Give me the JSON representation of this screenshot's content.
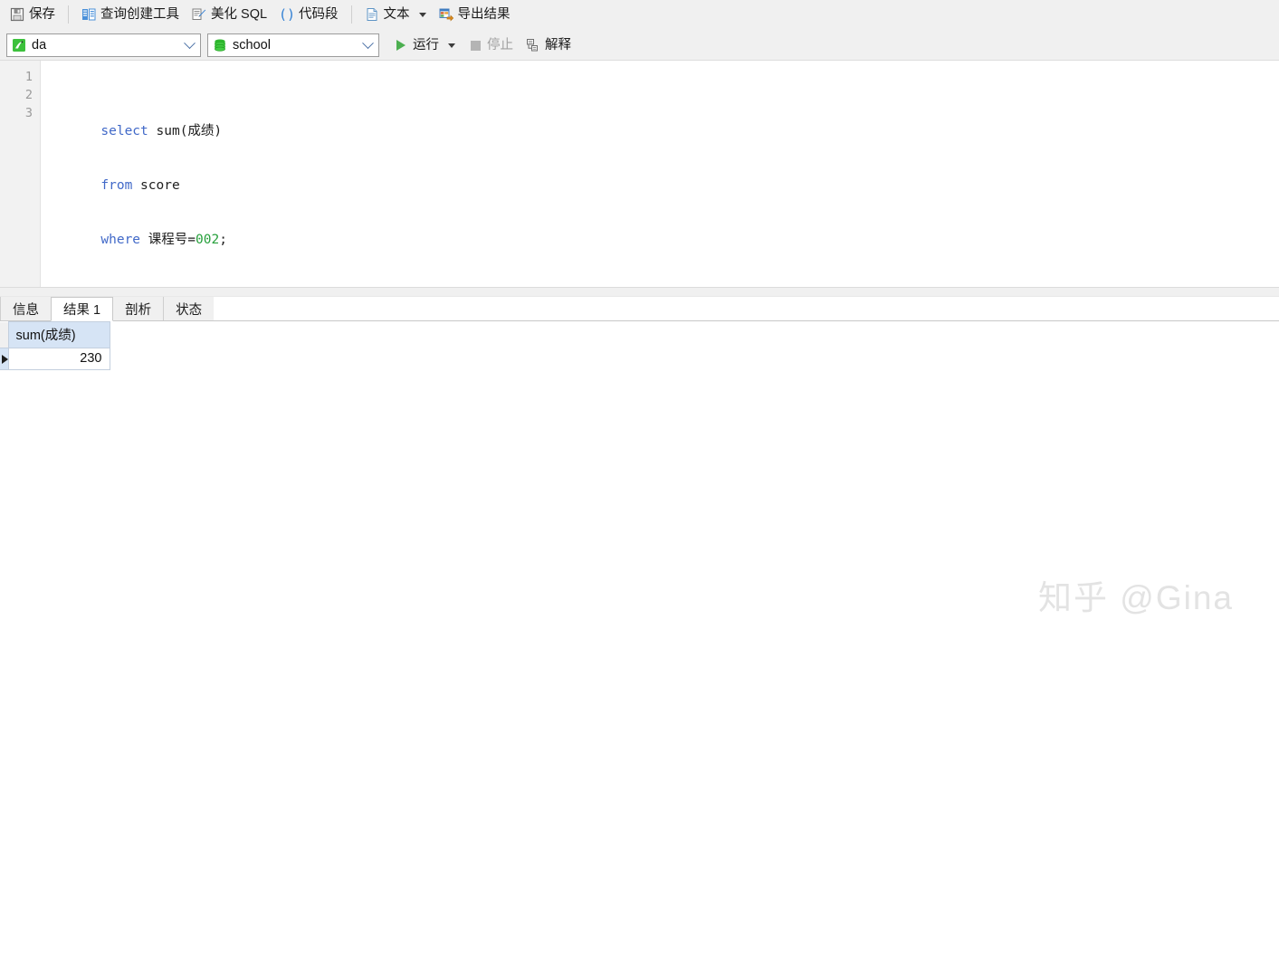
{
  "toolbar_main": {
    "buttons": [
      {
        "id": "save",
        "label": "保存",
        "icon": "save-icon"
      },
      {
        "id": "query-builder",
        "label": "查询创建工具",
        "icon": "query-builder-icon"
      },
      {
        "id": "beautify-sql",
        "label": "美化 SQL",
        "icon": "beautify-icon"
      },
      {
        "id": "code-snippet",
        "label": "代码段",
        "icon": "code-snippet-icon"
      },
      {
        "id": "text",
        "label": "文本",
        "icon": "text-file-icon",
        "has_dropdown": true
      },
      {
        "id": "export-result",
        "label": "导出结果",
        "icon": "export-icon"
      }
    ]
  },
  "toolbar_secondary": {
    "connection": {
      "value": "da",
      "icon": "connection-icon"
    },
    "database": {
      "value": "school",
      "icon": "database-icon"
    },
    "run": {
      "label": "运行",
      "icon": "play-icon",
      "has_dropdown": true,
      "enabled": true
    },
    "stop": {
      "label": "停止",
      "icon": "stop-icon",
      "enabled": false
    },
    "explain": {
      "label": "解释",
      "icon": "explain-icon",
      "enabled": true
    }
  },
  "editor": {
    "line_numbers": [
      "1",
      "2",
      "3"
    ],
    "lines": [
      [
        {
          "t": "select",
          "c": "kw"
        },
        {
          "t": " sum(成绩)",
          "c": "plain"
        }
      ],
      [
        {
          "t": "from",
          "c": "kw"
        },
        {
          "t": " score",
          "c": "plain"
        }
      ],
      [
        {
          "t": "where",
          "c": "kw"
        },
        {
          "t": " 课程号=",
          "c": "plain"
        },
        {
          "t": "002",
          "c": "num"
        },
        {
          "t": ";",
          "c": "plain"
        }
      ]
    ],
    "plain_text": "select sum(成绩)\nfrom score\nwhere 课程号=002;"
  },
  "result_panel": {
    "tabs": [
      {
        "id": "info",
        "label": "信息",
        "active": false
      },
      {
        "id": "result1",
        "label": "结果 1",
        "active": true
      },
      {
        "id": "profile",
        "label": "剖析",
        "active": false
      },
      {
        "id": "status",
        "label": "状态",
        "active": false
      }
    ],
    "grid": {
      "columns": [
        "sum(成绩)"
      ],
      "rows": [
        {
          "selected": true,
          "values": [
            "230"
          ]
        }
      ]
    }
  },
  "watermark": {
    "text": "知乎 @Gina"
  },
  "colors": {
    "toolbar_bg": "#f0f0f0",
    "keyword": "#4169c8",
    "number": "#27a03c",
    "grid_header_bg": "#d6e4f5",
    "grid_border": "#c3cfde",
    "run_green": "#4caf50",
    "watermark": "#e3e3e3"
  }
}
